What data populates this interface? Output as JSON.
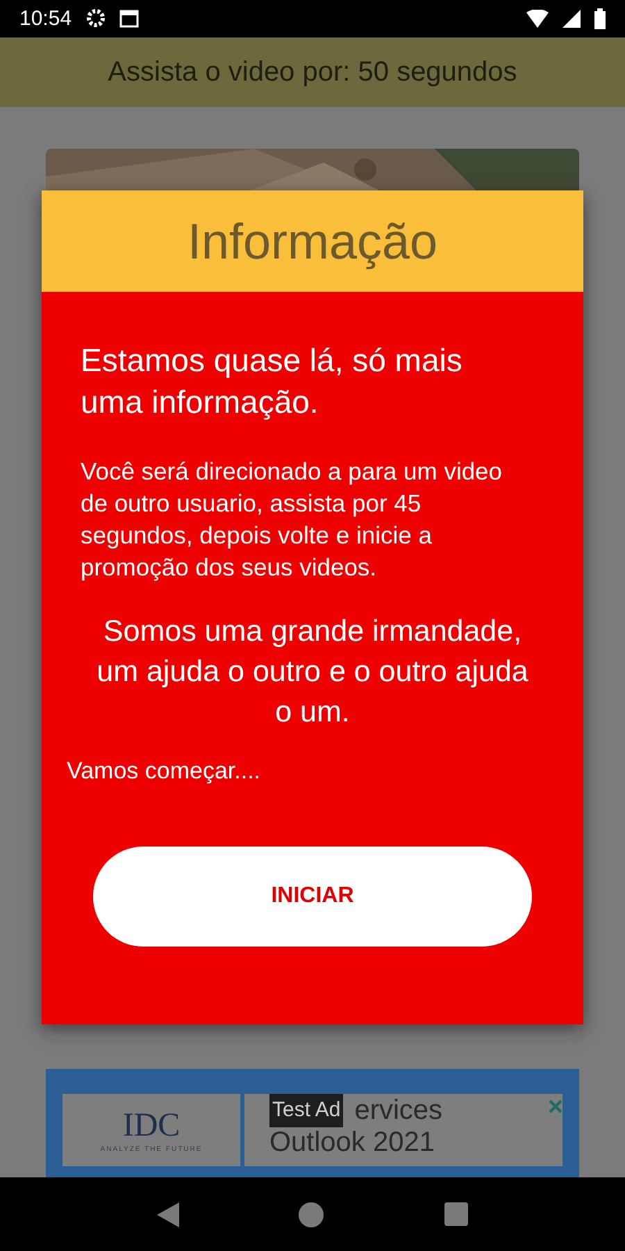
{
  "status_bar": {
    "time": "10:54"
  },
  "header": {
    "title": "Assista o video por: 50 segundos"
  },
  "ad": {
    "logo": "IDC",
    "tagline": "ANALYZE THE FUTURE",
    "label": "Test Ad",
    "line_1": "ervices",
    "line_2": "Outlook 2021"
  },
  "dialog": {
    "title": "Informação",
    "lead": "Estamos quase lá, só mais uma informação.",
    "body": "Você será direcionado a para um video de outro usuario, assista por 45 segundos, depois volte e inicie a promoção dos seus videos.",
    "motto": "Somos uma grande irmandade, um ajuda o outro e o outro ajuda o um.",
    "closing": "Vamos começar....",
    "button": "INICIAR"
  }
}
